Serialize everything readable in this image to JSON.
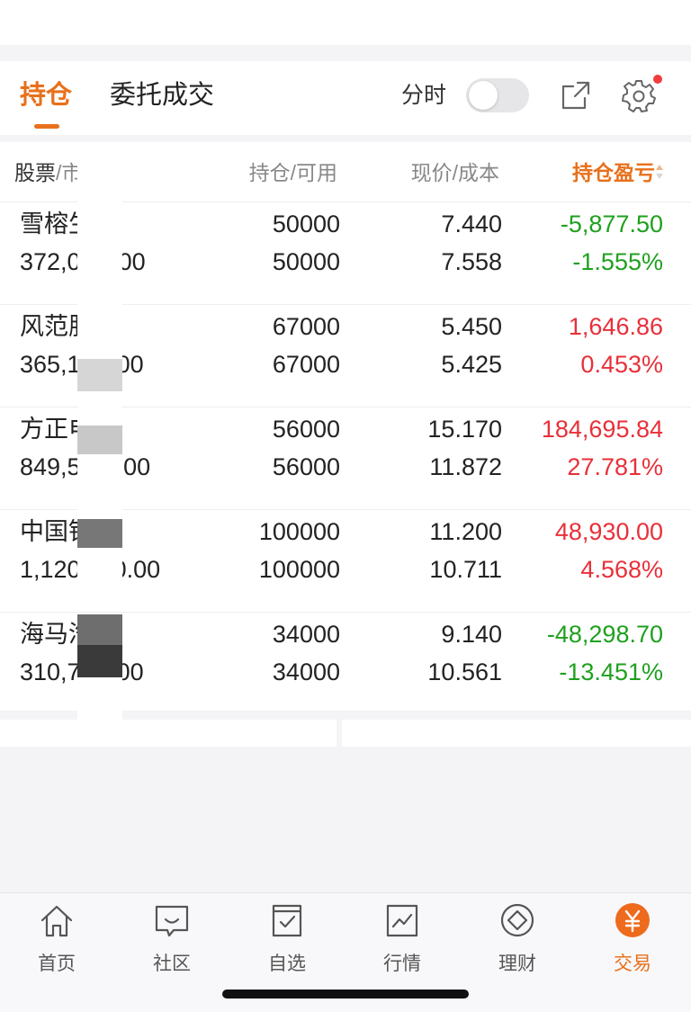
{
  "tabs": {
    "active": "持仓",
    "inactive": "委托成交"
  },
  "toolbar": {
    "fenshi_label": "分时",
    "fenshi_on": false
  },
  "table": {
    "header": {
      "name": "股票",
      "name_sep": "/",
      "name_sub": "市值",
      "position": "持仓/可用",
      "price": "现价/成本",
      "pnl": "持仓盈亏"
    },
    "rows": [
      {
        "name": "雪榕生",
        "market_value": "372,0",
        "market_value_tail": "00",
        "qty": "50000",
        "available": "50000",
        "price": "7.440",
        "cost": "7.558",
        "pnl": "-5,877.50",
        "pnl_pct": "-1.555%",
        "direction": "down"
      },
      {
        "name": "风范股",
        "market_value": "365,1",
        "market_value_tail": "00",
        "qty": "67000",
        "available": "67000",
        "price": "5.450",
        "cost": "5.425",
        "pnl": "1,646.86",
        "pnl_pct": "0.453%",
        "direction": "up"
      },
      {
        "name": "方正电",
        "market_value": "849,5",
        "market_value_tail": ".00",
        "qty": "56000",
        "available": "56000",
        "price": "15.170",
        "cost": "11.872",
        "pnl": "184,695.84",
        "pnl_pct": "27.781%",
        "direction": "up"
      },
      {
        "name": "中国银",
        "market_value": "1,120",
        "market_value_tail": "0.00",
        "qty": "100000",
        "available": "100000",
        "price": "11.200",
        "cost": "10.711",
        "pnl": "48,930.00",
        "pnl_pct": "4.568%",
        "direction": "up"
      },
      {
        "name": "海马汽",
        "market_value": "310,7",
        "market_value_tail": "00",
        "qty": "34000",
        "available": "34000",
        "price": "9.140",
        "cost": "10.561",
        "pnl": "-48,298.70",
        "pnl_pct": "-13.451%",
        "direction": "down"
      }
    ]
  },
  "nav": [
    {
      "label": "首页",
      "icon": "home-icon"
    },
    {
      "label": "社区",
      "icon": "community-icon"
    },
    {
      "label": "自选",
      "icon": "watchlist-icon"
    },
    {
      "label": "行情",
      "icon": "market-icon"
    },
    {
      "label": "理财",
      "icon": "wealth-icon"
    },
    {
      "label": "交易",
      "icon": "trade-icon"
    }
  ],
  "colors": {
    "accent": "#e8701c",
    "up": "#e8303a",
    "down": "#1fa01f"
  }
}
